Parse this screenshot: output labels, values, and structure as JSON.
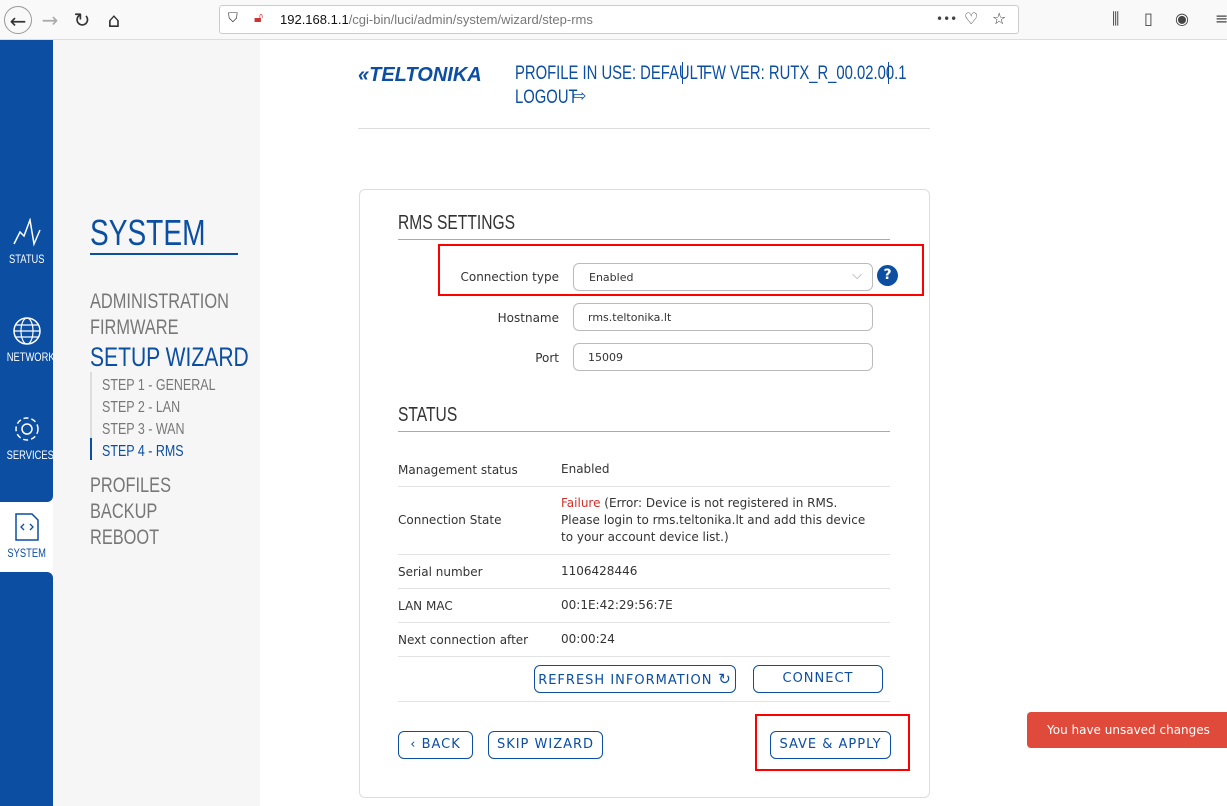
{
  "browser": {
    "url_host": "192.168.1.1",
    "url_path": "/cgi-bin/luci/admin/system/wizard/step-rms",
    "more": "•••"
  },
  "header": {
    "logo": "TELTONIKA",
    "profile": "PROFILE IN USE: DEFAULT",
    "fw": "FW VER: RUTX_R_00.02.00.1",
    "logout": "LOGOUT"
  },
  "rail": [
    {
      "label": "STATUS",
      "icon": "pulse-icon"
    },
    {
      "label": "NETWORK",
      "icon": "globe-icon"
    },
    {
      "label": "SERVICES",
      "icon": "gear-icon"
    },
    {
      "label": "SYSTEM",
      "icon": "code-file-icon",
      "active": true
    }
  ],
  "submenu": {
    "title": "SYSTEM",
    "items": [
      "ADMINISTRATION",
      "FIRMWARE",
      "SETUP WIZARD",
      "PROFILES",
      "BACKUP",
      "REBOOT"
    ],
    "steps": [
      "STEP 1 - GENERAL",
      "STEP 2 - LAN",
      "STEP 3 - WAN",
      "STEP 4 - RMS"
    ],
    "active_step": "STEP 4 - RMS"
  },
  "rms": {
    "title": "RMS SETTINGS",
    "connection_type_label": "Connection type",
    "connection_type": "Enabled",
    "hostname_label": "Hostname",
    "hostname": "rms.teltonika.lt",
    "port_label": "Port",
    "port": "15009"
  },
  "status": {
    "title": "STATUS",
    "rows": [
      {
        "key": "Management status",
        "value": "Enabled"
      },
      {
        "key": "Connection State",
        "value_status": "Failure",
        "value": " (Error: Device is not registered in RMS. Please login to rms.teltonika.lt and add this device to your account device list.)"
      },
      {
        "key": "Serial number",
        "value": "1106428446"
      },
      {
        "key": "LAN MAC",
        "value": "00:1E:42:29:56:7E"
      },
      {
        "key": "Next connection after",
        "value": "00:00:24"
      }
    ]
  },
  "buttons": {
    "refresh": "REFRESH INFORMATION",
    "connect": "CONNECT",
    "back": "BACK",
    "skip": "SKIP WIZARD",
    "save": "SAVE & APPLY"
  },
  "toast": {
    "text": "You have unsaved changes",
    "close": "×"
  },
  "colors": {
    "brand": "#0b4ea2",
    "failure": "#d0302a",
    "toast": "#e04a3a",
    "highlight": "#ff0000"
  }
}
